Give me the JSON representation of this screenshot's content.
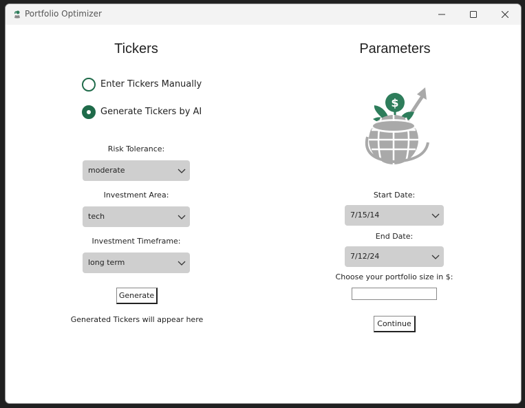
{
  "window": {
    "title": "Portfolio Optimizer",
    "controls": [
      "minimize-icon",
      "maximize-icon",
      "close-icon"
    ]
  },
  "tickers": {
    "heading": "Tickers",
    "radio_options": [
      {
        "label": "Enter Tickers Manually",
        "selected": false
      },
      {
        "label": "Generate Tickers by AI",
        "selected": true
      }
    ],
    "risk_tolerance": {
      "label": "Risk Tolerance:",
      "value": "moderate"
    },
    "investment_area": {
      "label": "Investment Area:",
      "value": "tech"
    },
    "investment_timeframe": {
      "label": "Investment Timeframe:",
      "value": "long term"
    },
    "generate_button": "Generate",
    "generated_note": "Generated Tickers will appear here"
  },
  "parameters": {
    "heading": "Parameters",
    "logo_icon": "money-plant-growth-icon",
    "start_date": {
      "label": "Start Date:",
      "value": "7/15/14"
    },
    "end_date": {
      "label": "End Date:",
      "value": "7/12/24"
    },
    "portfolio_size": {
      "label": "Choose your portfolio size in $:",
      "value": ""
    },
    "continue_button": "Continue"
  },
  "colors": {
    "accent": "#1f6b4a",
    "logo_green": "#2e7d5b",
    "logo_gray": "#a9a9a9",
    "dropdown_bg": "#cfcfcf"
  }
}
